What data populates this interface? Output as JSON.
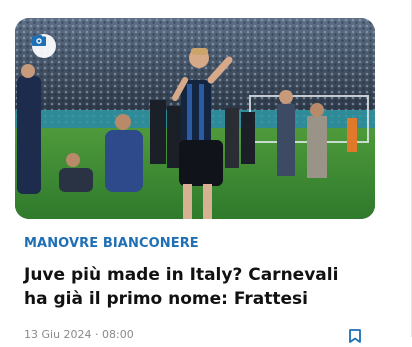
{
  "article": {
    "category": "MANOVRE BIANCONERE",
    "headline": "Juve più made in Italy? Carnevali ha già il primo nome: Frattesi",
    "meta": "13 Giu 2024 · 08:00",
    "image_icon": "camera-icon",
    "bookmark_icon": "bookmark-icon"
  },
  "colors": {
    "category": "#1f6fb5",
    "headline": "#111111",
    "meta": "#8a8a8a"
  }
}
